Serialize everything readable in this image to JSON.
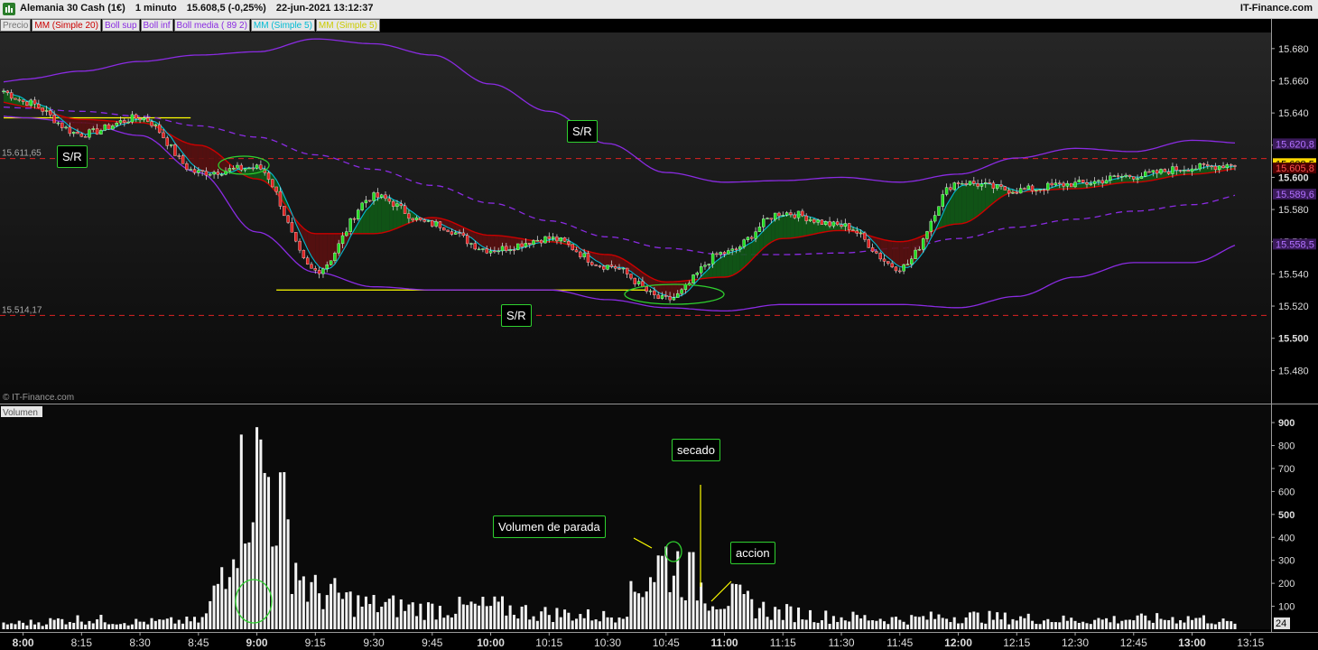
{
  "header": {
    "instrument": "Alemania 30 Cash (1€)",
    "timeframe": "1 minuto",
    "last_quote": "15.608,5 (-0,25%)",
    "datetime": "22-jun-2021 13:12:37",
    "brand": "IT-Finance.com"
  },
  "legend": {
    "items": [
      {
        "label": "Precio",
        "color": "#777777"
      },
      {
        "label": "MM (Simple 20)",
        "color": "#cc0000"
      },
      {
        "label": "Boll sup",
        "color": "#8a2be2"
      },
      {
        "label": "Boll inf",
        "color": "#8a2be2"
      },
      {
        "label": "Boll media ( 89 2)",
        "color": "#8a2be2"
      },
      {
        "label": "MM (Simple 5)",
        "color": "#00bcd4"
      },
      {
        "label": "MM (Simple 5)",
        "color": "#cccc00"
      }
    ]
  },
  "watermark": "© IT-Finance.com",
  "volume_label": "Volumen",
  "annotations": {
    "sr1": "S/R",
    "sr2": "S/R",
    "sr3": "S/R",
    "volumen_parada": "Volumen de parada",
    "secado": "secado",
    "accion": "accion"
  },
  "level_labels": {
    "upper": "15.611,65",
    "lower": "15.514,17"
  },
  "right_badges": {
    "boll_sup": "15.620,8",
    "last": "15.608,5",
    "mm20": "15.605,8",
    "boll_media": "15.589,6",
    "boll_inf": "15.558,5"
  },
  "volume_badge": "24",
  "colors": {
    "up_candle": "#22dd22",
    "down_candle": "#dd2222",
    "mm20": "#cc0000",
    "bollinger": "#8a2be2",
    "mm5": "#00bcd4",
    "sr_line": "#ffff00",
    "level_line": "#dd2222",
    "annotation_border": "#2fd02f"
  },
  "chart_data": [
    {
      "type": "line",
      "title": "Alemania 30 Cash (1€) 1 minuto",
      "xlabel": "",
      "ylabel": "",
      "x": [
        "8:00",
        "8:15",
        "8:30",
        "8:45",
        "9:00",
        "9:15",
        "9:30",
        "9:45",
        "10:00",
        "10:15",
        "10:30",
        "10:45",
        "11:00",
        "11:15",
        "11:30",
        "11:45",
        "12:00",
        "12:15",
        "12:30",
        "12:45",
        "13:00",
        "13:15"
      ],
      "ylim": [
        15460,
        15690
      ],
      "yticks": [
        "15.680",
        "15.660",
        "15.640",
        "15.620",
        "15.600",
        "15.580",
        "15.560",
        "15.540",
        "15.520",
        "15.500",
        "15.480"
      ],
      "series": [
        {
          "name": "Precio",
          "values": [
            15647,
            15627,
            15637,
            15603,
            15606,
            15542,
            15588,
            15571,
            15555,
            15562,
            15545,
            15524,
            15553,
            15578,
            15570,
            15544,
            15597,
            15592,
            15596,
            15601,
            15606,
            15609
          ]
        },
        {
          "name": "MM (Simple 20)",
          "values": [
            15644,
            15636,
            15634,
            15620,
            15599,
            15565,
            15565,
            15575,
            15564,
            15560,
            15552,
            15535,
            15538,
            15562,
            15567,
            15560,
            15571,
            15591,
            15593,
            15597,
            15602,
            15606
          ]
        },
        {
          "name": "Boll sup",
          "values": [
            15661,
            15666,
            15672,
            15676,
            15678,
            15686,
            15683,
            15676,
            15658,
            15641,
            15621,
            15603,
            15597,
            15598,
            15600,
            15597,
            15602,
            15612,
            15618,
            15616,
            15623,
            15621
          ]
        },
        {
          "name": "Boll inf",
          "values": [
            15637,
            15634,
            15626,
            15603,
            15566,
            15541,
            15532,
            15530,
            15530,
            15530,
            15524,
            15519,
            15517,
            15521,
            15521,
            15521,
            15519,
            15526,
            15538,
            15547,
            15547,
            15560
          ]
        },
        {
          "name": "Boll media ( 89 2)",
          "values": [
            15643,
            15641,
            15638,
            15632,
            15625,
            15614,
            15605,
            15595,
            15584,
            15573,
            15563,
            15556,
            15552,
            15552,
            15553,
            15556,
            15562,
            15569,
            15574,
            15579,
            15583,
            15590
          ]
        }
      ],
      "reference_levels": [
        15611.65,
        15514.17
      ],
      "sr_segments": [
        {
          "from": "7:55",
          "to": "8:43",
          "value": 15637
        },
        {
          "from": "9:05",
          "to": "10:40",
          "value": 15530
        }
      ]
    },
    {
      "type": "bar",
      "title": "Volumen",
      "x": [
        "8:00",
        "8:15",
        "8:30",
        "8:45",
        "9:00",
        "9:15",
        "9:30",
        "9:45",
        "10:00",
        "10:15",
        "10:30",
        "10:45",
        "11:00",
        "11:15",
        "11:30",
        "11:45",
        "12:00",
        "12:15",
        "12:30",
        "12:45",
        "13:00",
        "13:15"
      ],
      "ylim": [
        0,
        920
      ],
      "yticks": [
        "900",
        "800",
        "700",
        "600",
        "500",
        "400",
        "300",
        "200",
        "100"
      ],
      "values": [
        35,
        55,
        40,
        45,
        880,
        200,
        130,
        110,
        120,
        85,
        70,
        360,
        170,
        90,
        65,
        55,
        70,
        60,
        50,
        55,
        60,
        24
      ],
      "last_value": 24
    }
  ]
}
